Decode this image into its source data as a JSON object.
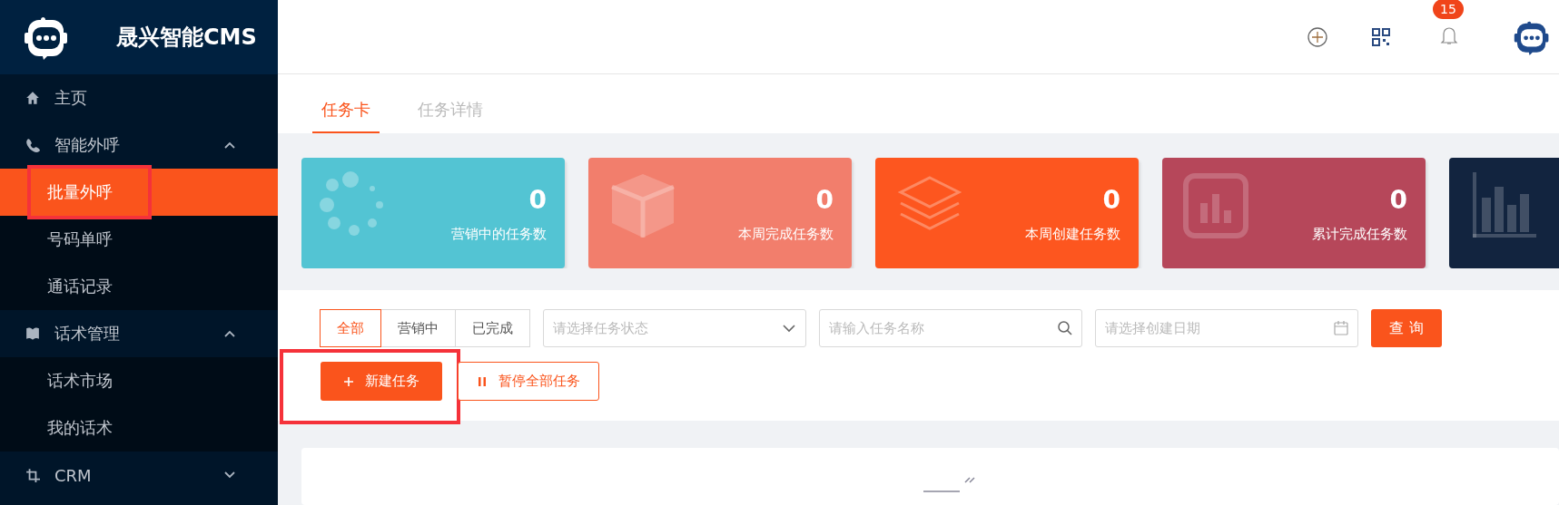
{
  "brand": {
    "title": "晟兴智能CMS"
  },
  "header": {
    "notification_count": "15"
  },
  "sidebar": {
    "items": [
      {
        "kind": "item",
        "label": "主页"
      },
      {
        "kind": "group",
        "label": "智能外呼",
        "expanded": true,
        "children": [
          {
            "label": "批量外呼",
            "selected": true,
            "highlighted": true
          },
          {
            "label": "号码单呼",
            "selected": false,
            "highlighted": false
          },
          {
            "label": "通话记录",
            "selected": false,
            "highlighted": false
          }
        ]
      },
      {
        "kind": "group",
        "label": "话术管理",
        "expanded": true,
        "children": [
          {
            "label": "话术市场",
            "selected": false,
            "highlighted": false
          },
          {
            "label": "我的话术",
            "selected": false,
            "highlighted": false
          }
        ]
      },
      {
        "kind": "group",
        "label": "CRM",
        "expanded": false
      }
    ]
  },
  "tabs": [
    {
      "label": "任务卡",
      "selected": true
    },
    {
      "label": "任务详情",
      "selected": false
    }
  ],
  "stat_cards": [
    {
      "value": "0",
      "label": "营销中的任务数",
      "color": "#53c4d3"
    },
    {
      "value": "0",
      "label": "本周完成任务数",
      "color": "#f27e6c"
    },
    {
      "value": "0",
      "label": "本周创建任务数",
      "color": "#fd561f"
    },
    {
      "value": "0",
      "label": "累计完成任务数",
      "color": "#b6475a"
    },
    {
      "color": "#12243f"
    }
  ],
  "filters": {
    "segments": [
      {
        "label": "全部",
        "selected": true
      },
      {
        "label": "营销中",
        "selected": false
      },
      {
        "label": "已完成",
        "selected": false
      }
    ],
    "status_select": {
      "placeholder": "请选择任务状态"
    },
    "name_input": {
      "placeholder": "请输入任务名称"
    },
    "date_input": {
      "placeholder": "请选择创建日期"
    },
    "query_button": "查 询"
  },
  "actions": [
    {
      "kind": "primary",
      "label": "新建任务",
      "highlighted": true
    },
    {
      "kind": "outline",
      "label": "暂停全部任务",
      "highlighted": false
    }
  ]
}
